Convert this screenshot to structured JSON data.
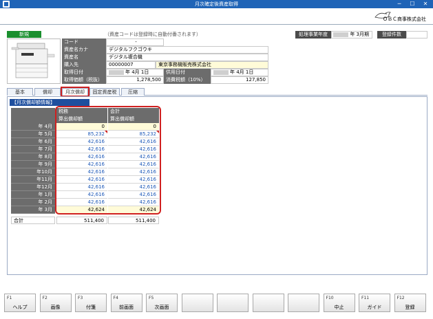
{
  "window": {
    "title": "月次確定後資産取得",
    "minimize": "─",
    "maximize": "☐",
    "close": "✕"
  },
  "header": {
    "company": "ＯＢＣ商事株式会社",
    "fiscal_label": "処理事業年度",
    "fiscal_value": "年  3月期",
    "count_label": "登録件数",
    "count_value": ""
  },
  "asset": {
    "new_badge": "新規",
    "code_note": "（資産コードは登録時に自動付番されます）",
    "code_label": "コード",
    "code_value": "-",
    "kana_label": "資産名カナ",
    "kana_value": "デジタルフクゴウキ",
    "name_label": "資産名",
    "name_value": "デジタル複合機",
    "supplier_label": "購入先",
    "supplier_code": "00000007",
    "supplier_name": "東京事務機販売株式会社",
    "acq_date_label": "取得日付",
    "acq_date_value": "年  4月  1日",
    "use_date_label": "供用日付",
    "use_date_value": "年  4月  1日",
    "acq_price_label": "取得価額（税抜）",
    "acq_price_value": "1,278,500",
    "tax_label": "消費税額（10%）",
    "tax_value": "127,850"
  },
  "tabs": [
    "基本",
    "償却",
    "月次償却",
    "固定資産税",
    "圧縮"
  ],
  "section_title": "【月次償却額情報】",
  "table": {
    "col1_header": "税務",
    "col2_header": "会計",
    "col1_sub": "算出償却額",
    "col2_sub": "算出償却額",
    "months": [
      "年  4月",
      "年  5月",
      "年  6月",
      "年  7月",
      "年  8月",
      "年  9月",
      "年10月",
      "年11月",
      "年12月",
      "年  1月",
      "年  2月",
      "年  3月"
    ],
    "tax_values": [
      "0",
      "85,232",
      "42,616",
      "42,616",
      "42,616",
      "42,616",
      "42,616",
      "42,616",
      "42,616",
      "42,616",
      "42,616",
      "42,624"
    ],
    "acc_values": [
      "0",
      "85,232",
      "42,616",
      "42,616",
      "42,616",
      "42,616",
      "42,616",
      "42,616",
      "42,616",
      "42,616",
      "42,616",
      "42,624"
    ],
    "total_label": "合計",
    "total_tax": "511,400",
    "total_acc": "511,400"
  },
  "fkeys": [
    {
      "key": "F1",
      "label": "ヘルプ"
    },
    {
      "key": "F2",
      "label": "画像"
    },
    {
      "key": "F3",
      "label": "付箋"
    },
    {
      "key": "F4",
      "label": "前画面"
    },
    {
      "key": "F5",
      "label": "次画面"
    },
    {
      "key": "",
      "label": ""
    },
    {
      "key": "",
      "label": ""
    },
    {
      "key": "",
      "label": ""
    },
    {
      "key": "",
      "label": ""
    },
    {
      "key": "F10",
      "label": "中止"
    },
    {
      "key": "F11",
      "label": "ガイド"
    },
    {
      "key": "F12",
      "label": "登録"
    }
  ],
  "colors": {
    "titlebar": "#1f64b7",
    "new_badge": "#1a8f2e",
    "highlight": "#d02020",
    "blue_value": "#1c58b8"
  }
}
